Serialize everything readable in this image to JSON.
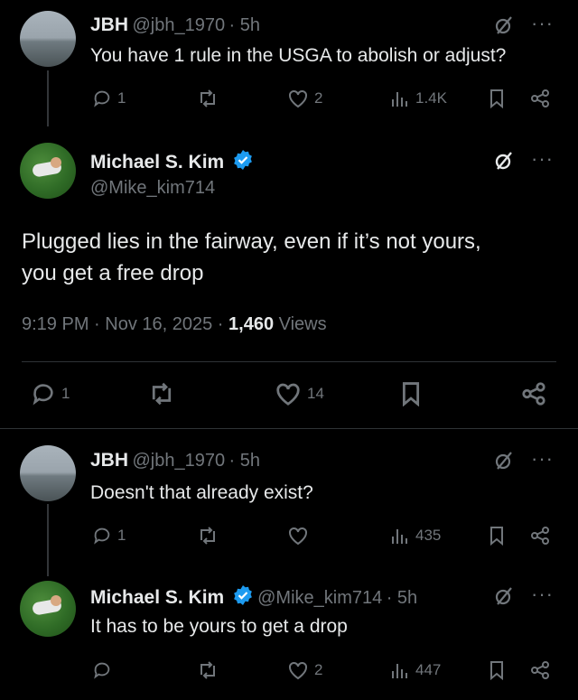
{
  "reply1": {
    "name": "JBH",
    "handle": "@jbh_1970",
    "time": "· 5h",
    "text": "You have 1 rule in the USGA to abolish or adjust?",
    "replies": "1",
    "reposts": "",
    "likes": "2",
    "views": "1.4K"
  },
  "main": {
    "name": "Michael S. Kim",
    "handle": "@Mike_kim714",
    "text_line1": "Plugged lies in the fairway, even if it’s not yours,",
    "text_line2": "you get a free drop",
    "timestamp": "9:19 PM · Nov 16, 2025 · ",
    "views_count": "1,460",
    "views_label": " Views",
    "replies": "1",
    "likes": "14"
  },
  "reply2": {
    "name": "JBH",
    "handle": "@jbh_1970",
    "time": "· 5h",
    "text": "Doesn't that already exist?",
    "replies": "1",
    "likes": "",
    "views": "435"
  },
  "reply3": {
    "name": "Michael S. Kim",
    "handle": "@Mike_kim714",
    "time": "· 5h",
    "text": "It has to be yours to get a drop",
    "replies": "",
    "likes": "2",
    "views": "447"
  },
  "colors": {
    "background": "#000000",
    "text": "#e7e9ea",
    "muted": "#71767b",
    "verified": "#1d9bf0",
    "divider": "#2f3336"
  }
}
